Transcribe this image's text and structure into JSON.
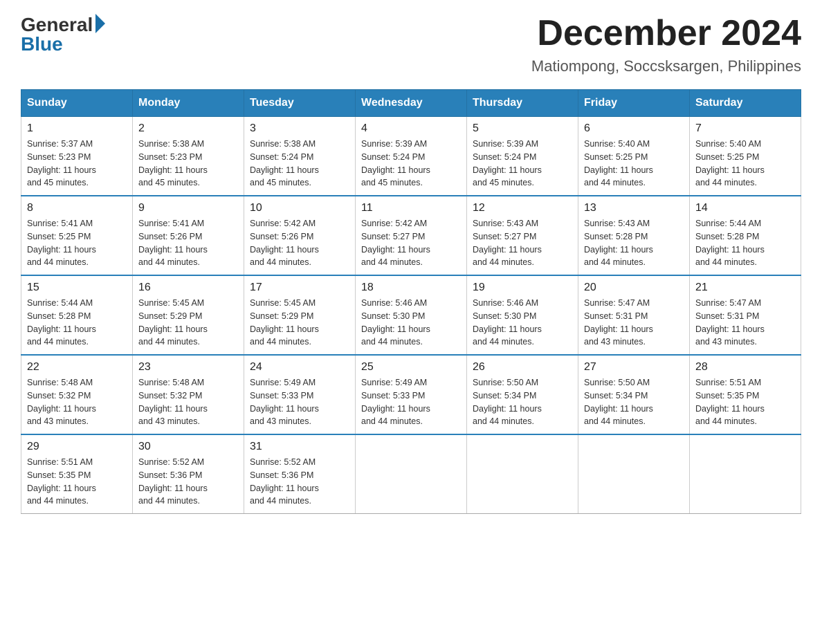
{
  "logo": {
    "general": "General",
    "blue": "Blue"
  },
  "header": {
    "month": "December 2024",
    "location": "Matiompong, Soccsksargen, Philippines"
  },
  "days_of_week": [
    "Sunday",
    "Monday",
    "Tuesday",
    "Wednesday",
    "Thursday",
    "Friday",
    "Saturday"
  ],
  "weeks": [
    [
      {
        "day": "1",
        "sunrise": "5:37 AM",
        "sunset": "5:23 PM",
        "daylight": "11 hours and 45 minutes."
      },
      {
        "day": "2",
        "sunrise": "5:38 AM",
        "sunset": "5:23 PM",
        "daylight": "11 hours and 45 minutes."
      },
      {
        "day": "3",
        "sunrise": "5:38 AM",
        "sunset": "5:24 PM",
        "daylight": "11 hours and 45 minutes."
      },
      {
        "day": "4",
        "sunrise": "5:39 AM",
        "sunset": "5:24 PM",
        "daylight": "11 hours and 45 minutes."
      },
      {
        "day": "5",
        "sunrise": "5:39 AM",
        "sunset": "5:24 PM",
        "daylight": "11 hours and 45 minutes."
      },
      {
        "day": "6",
        "sunrise": "5:40 AM",
        "sunset": "5:25 PM",
        "daylight": "11 hours and 44 minutes."
      },
      {
        "day": "7",
        "sunrise": "5:40 AM",
        "sunset": "5:25 PM",
        "daylight": "11 hours and 44 minutes."
      }
    ],
    [
      {
        "day": "8",
        "sunrise": "5:41 AM",
        "sunset": "5:25 PM",
        "daylight": "11 hours and 44 minutes."
      },
      {
        "day": "9",
        "sunrise": "5:41 AM",
        "sunset": "5:26 PM",
        "daylight": "11 hours and 44 minutes."
      },
      {
        "day": "10",
        "sunrise": "5:42 AM",
        "sunset": "5:26 PM",
        "daylight": "11 hours and 44 minutes."
      },
      {
        "day": "11",
        "sunrise": "5:42 AM",
        "sunset": "5:27 PM",
        "daylight": "11 hours and 44 minutes."
      },
      {
        "day": "12",
        "sunrise": "5:43 AM",
        "sunset": "5:27 PM",
        "daylight": "11 hours and 44 minutes."
      },
      {
        "day": "13",
        "sunrise": "5:43 AM",
        "sunset": "5:28 PM",
        "daylight": "11 hours and 44 minutes."
      },
      {
        "day": "14",
        "sunrise": "5:44 AM",
        "sunset": "5:28 PM",
        "daylight": "11 hours and 44 minutes."
      }
    ],
    [
      {
        "day": "15",
        "sunrise": "5:44 AM",
        "sunset": "5:28 PM",
        "daylight": "11 hours and 44 minutes."
      },
      {
        "day": "16",
        "sunrise": "5:45 AM",
        "sunset": "5:29 PM",
        "daylight": "11 hours and 44 minutes."
      },
      {
        "day": "17",
        "sunrise": "5:45 AM",
        "sunset": "5:29 PM",
        "daylight": "11 hours and 44 minutes."
      },
      {
        "day": "18",
        "sunrise": "5:46 AM",
        "sunset": "5:30 PM",
        "daylight": "11 hours and 44 minutes."
      },
      {
        "day": "19",
        "sunrise": "5:46 AM",
        "sunset": "5:30 PM",
        "daylight": "11 hours and 44 minutes."
      },
      {
        "day": "20",
        "sunrise": "5:47 AM",
        "sunset": "5:31 PM",
        "daylight": "11 hours and 43 minutes."
      },
      {
        "day": "21",
        "sunrise": "5:47 AM",
        "sunset": "5:31 PM",
        "daylight": "11 hours and 43 minutes."
      }
    ],
    [
      {
        "day": "22",
        "sunrise": "5:48 AM",
        "sunset": "5:32 PM",
        "daylight": "11 hours and 43 minutes."
      },
      {
        "day": "23",
        "sunrise": "5:48 AM",
        "sunset": "5:32 PM",
        "daylight": "11 hours and 43 minutes."
      },
      {
        "day": "24",
        "sunrise": "5:49 AM",
        "sunset": "5:33 PM",
        "daylight": "11 hours and 43 minutes."
      },
      {
        "day": "25",
        "sunrise": "5:49 AM",
        "sunset": "5:33 PM",
        "daylight": "11 hours and 44 minutes."
      },
      {
        "day": "26",
        "sunrise": "5:50 AM",
        "sunset": "5:34 PM",
        "daylight": "11 hours and 44 minutes."
      },
      {
        "day": "27",
        "sunrise": "5:50 AM",
        "sunset": "5:34 PM",
        "daylight": "11 hours and 44 minutes."
      },
      {
        "day": "28",
        "sunrise": "5:51 AM",
        "sunset": "5:35 PM",
        "daylight": "11 hours and 44 minutes."
      }
    ],
    [
      {
        "day": "29",
        "sunrise": "5:51 AM",
        "sunset": "5:35 PM",
        "daylight": "11 hours and 44 minutes."
      },
      {
        "day": "30",
        "sunrise": "5:52 AM",
        "sunset": "5:36 PM",
        "daylight": "11 hours and 44 minutes."
      },
      {
        "day": "31",
        "sunrise": "5:52 AM",
        "sunset": "5:36 PM",
        "daylight": "11 hours and 44 minutes."
      },
      null,
      null,
      null,
      null
    ]
  ],
  "labels": {
    "sunrise": "Sunrise:",
    "sunset": "Sunset:",
    "daylight": "Daylight:"
  }
}
